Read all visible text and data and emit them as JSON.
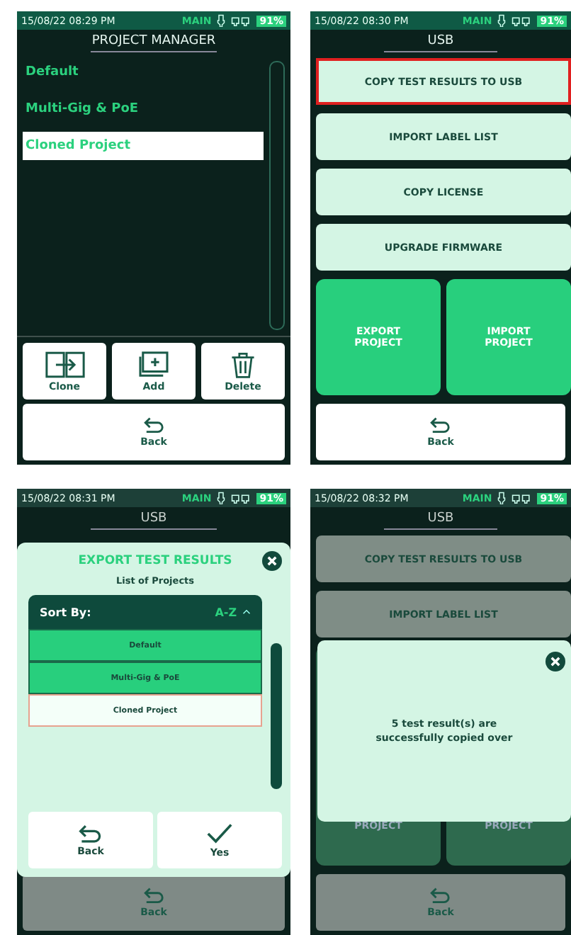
{
  "screens": [
    {
      "kind": "project_manager",
      "status": {
        "time": "15/08/22 08:29 PM",
        "mode": "MAIN",
        "battery": "91%"
      },
      "title": "PROJECT MANAGER",
      "projects": [
        {
          "name": "Default",
          "selected": false
        },
        {
          "name": "Multi-Gig & PoE",
          "selected": false
        },
        {
          "name": "Cloned Project",
          "selected": true
        }
      ],
      "actions": [
        {
          "label": "Clone",
          "kind": "clone"
        },
        {
          "label": "Add",
          "kind": "add"
        },
        {
          "label": "Delete",
          "kind": "delete"
        }
      ],
      "back": "Back"
    },
    {
      "kind": "usb",
      "status": {
        "time": "15/08/22 08:30 PM",
        "mode": "MAIN",
        "battery": "91%"
      },
      "title": "USB",
      "options": [
        {
          "label": "COPY TEST RESULTS TO USB",
          "highlighted": true
        },
        {
          "label": "IMPORT LABEL LIST",
          "highlighted": false
        },
        {
          "label": "COPY LICENSE",
          "highlighted": false
        },
        {
          "label": "UPGRADE FIRMWARE",
          "highlighted": false
        }
      ],
      "tiles": [
        "EXPORT PROJECT",
        "IMPORT PROJECT"
      ],
      "back": "Back"
    },
    {
      "kind": "export_dialog",
      "status": {
        "time": "15/08/22 08:31 PM",
        "mode": "MAIN",
        "battery": "91%"
      },
      "title": "USB",
      "dialog": {
        "title": "EXPORT TEST RESULTS",
        "subtitle": "List of Projects",
        "sort_label": "Sort By:",
        "sort_value": "A-Z",
        "projects": [
          {
            "name": "Default",
            "selected": true
          },
          {
            "name": "Multi-Gig & PoE",
            "selected": true
          },
          {
            "name": "Cloned Project",
            "selected": false
          }
        ],
        "buttons": [
          {
            "label": "Back",
            "kind": "back"
          },
          {
            "label": "Yes",
            "kind": "yes"
          }
        ]
      },
      "back": "Back"
    },
    {
      "kind": "usb_message",
      "status": {
        "time": "15/08/22 08:32 PM",
        "mode": "MAIN",
        "battery": "91%"
      },
      "title": "USB",
      "options": [
        {
          "label": "COPY TEST RESULTS TO USB",
          "highlighted": false
        },
        {
          "label": "IMPORT LABEL LIST",
          "highlighted": false
        }
      ],
      "tiles": [
        "PROJECT",
        "PROJECT"
      ],
      "message": "5 test result(s) are successfully copied over",
      "back": "Back"
    }
  ]
}
